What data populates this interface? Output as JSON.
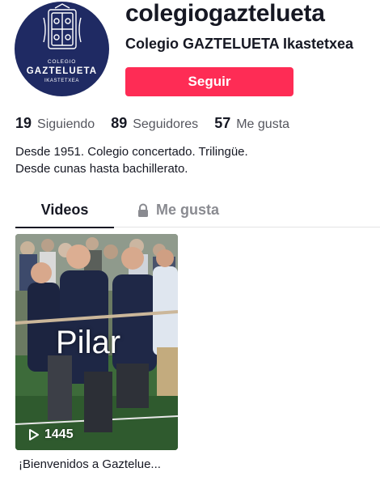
{
  "profile": {
    "username": "colegiogaztelueta",
    "display_name": "Colegio GAZTELUETA Ikastetxea",
    "follow_label": "Seguir",
    "avatar": {
      "line1": "COLEGIO",
      "line2": "GAZTELUETA",
      "line3": "IKASTETXEA",
      "background": "#1f2a63"
    },
    "accent_color": "#fe2c55"
  },
  "stats": {
    "following": {
      "count": "19",
      "label": "Siguiendo"
    },
    "followers": {
      "count": "89",
      "label": "Seguidores"
    },
    "likes": {
      "count": "57",
      "label": "Me gusta"
    }
  },
  "bio": {
    "line1": "Desde 1951. Colegio concertado. Trilingüe.",
    "line2": "Desde cunas hasta bachillerato."
  },
  "tabs": {
    "videos": "Videos",
    "liked": "Me gusta",
    "active": "videos"
  },
  "icons": {
    "liked_tab": "lock-icon",
    "views": "play-icon"
  },
  "videos": [
    {
      "overlay_text": "Pilar",
      "views": "1445",
      "title": "¡Bienvenidos a Gaztelue..."
    }
  ]
}
